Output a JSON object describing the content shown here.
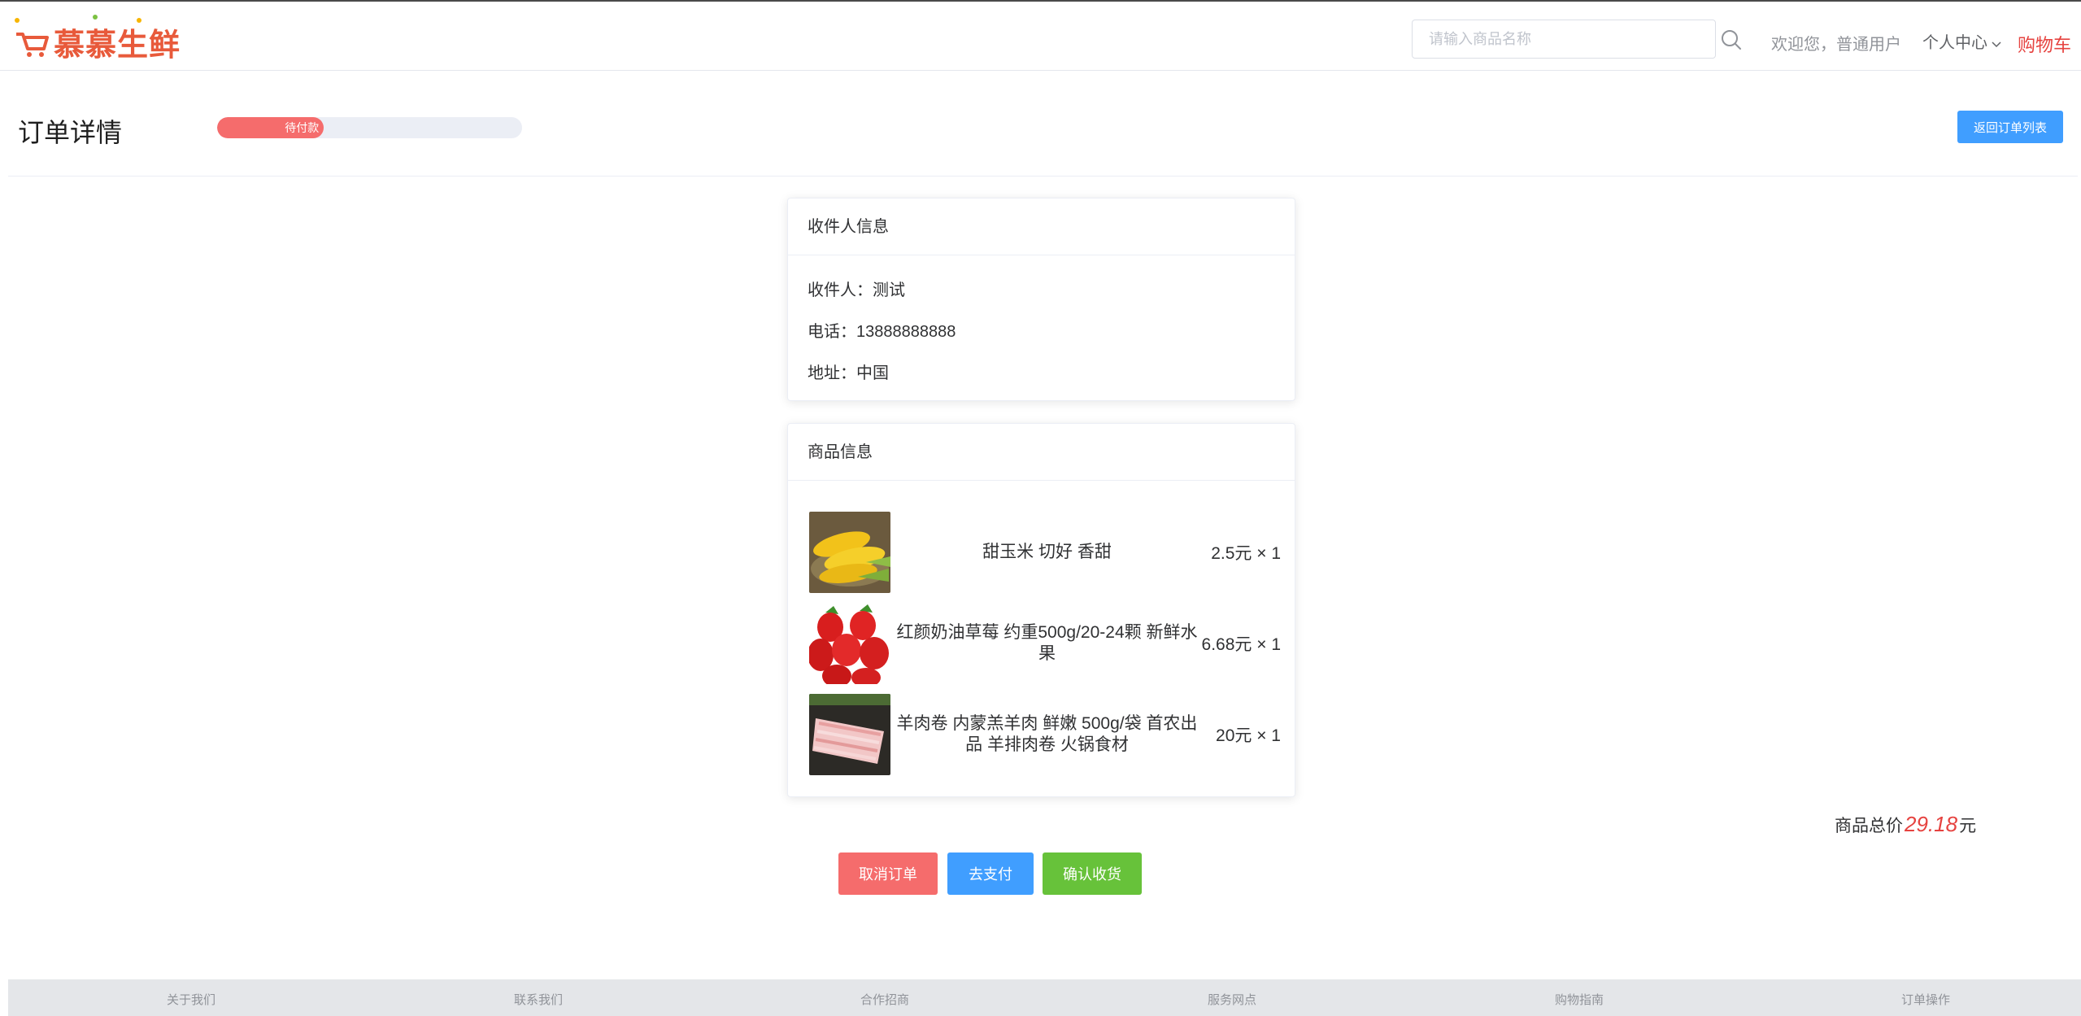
{
  "header": {
    "logo_text": "慕慕生鲜",
    "search_placeholder": "请输入商品名称",
    "search_value": "",
    "welcome": "欢迎您，普通用户",
    "user_center": "个人中心",
    "cart": "购物车"
  },
  "page": {
    "title": "订单详情",
    "status_label": "待付款",
    "status_progress_percent": 35,
    "back_button": "返回订单列表"
  },
  "receiver": {
    "heading": "收件人信息",
    "name": "收件人：测试",
    "phone": "电话：13888888888",
    "address": "地址：中国"
  },
  "goods": {
    "heading": "商品信息",
    "items": [
      {
        "name": "甜玉米 切好 香甜",
        "price": "2.5元 × 1",
        "image_icon": "corn"
      },
      {
        "name": "红颜奶油草莓 约重500g/20-24颗 新鲜水果",
        "price": "6.68元 × 1",
        "image_icon": "strawberry"
      },
      {
        "name": "羊肉卷 内蒙羔羊肉 鲜嫩 500g/袋 首农出品 羊排肉卷 火锅食材",
        "price": "20元 × 1",
        "image_icon": "mutton-roll"
      }
    ]
  },
  "total": {
    "label": "商品总价",
    "amount": "29.18",
    "unit": "元"
  },
  "actions": {
    "cancel": "取消订单",
    "pay": "去支付",
    "confirm": "确认收货"
  },
  "footer": {
    "items": [
      "关于我们",
      "联系我们",
      "合作招商",
      "服务网点",
      "购物指南",
      "订单操作"
    ]
  },
  "colors": {
    "accent_red": "#e64340",
    "primary_blue": "#409eff",
    "danger": "#f56c6c",
    "success": "#67c23a"
  }
}
